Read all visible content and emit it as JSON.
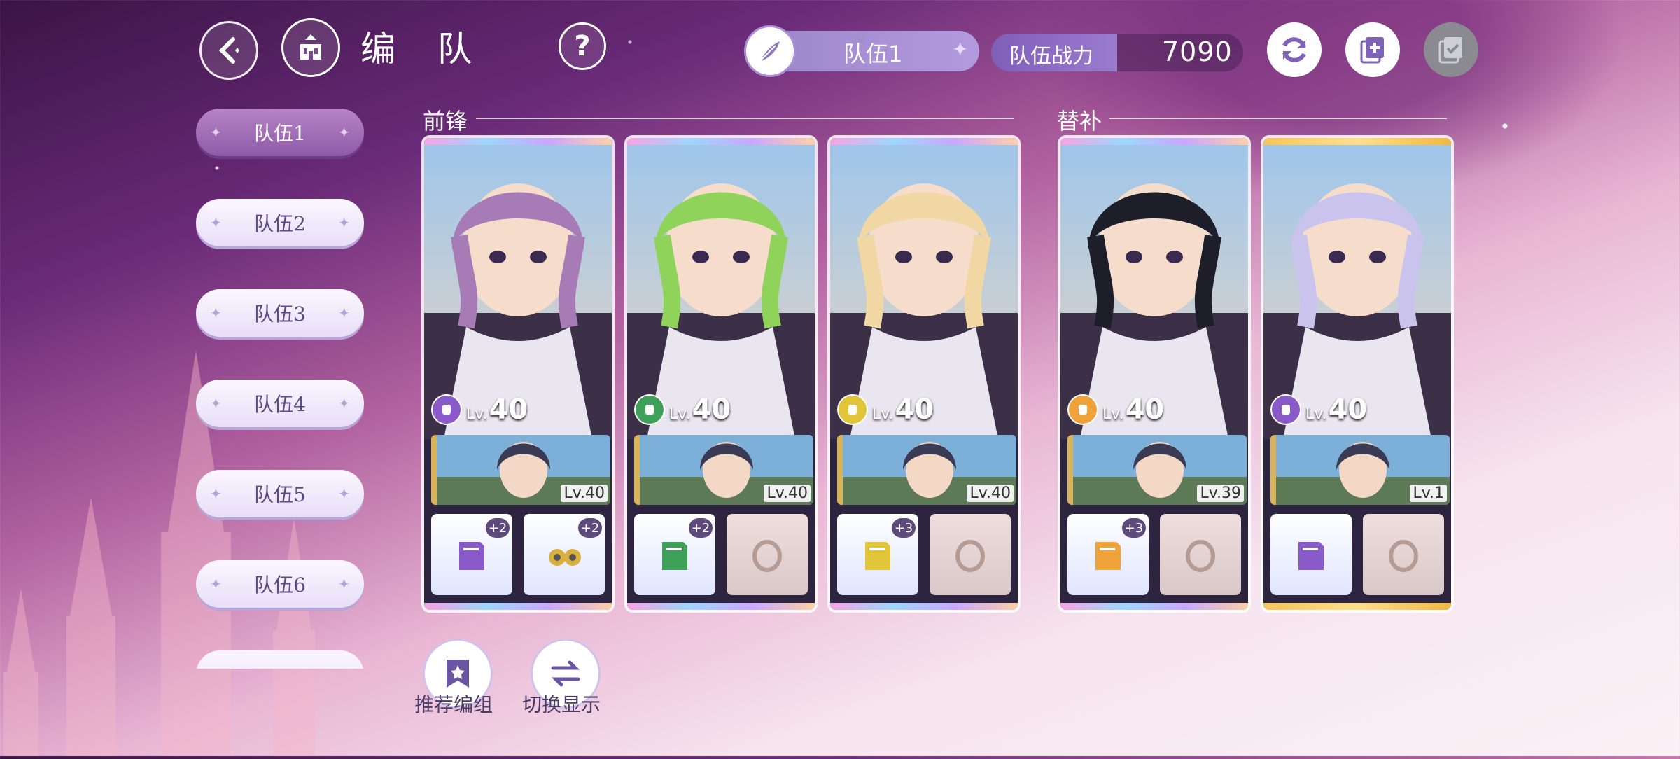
{
  "header": {
    "title": "编 队",
    "help_icon": "?",
    "current_team": "队伍1",
    "power_label": "队伍战力",
    "power_value": "7090"
  },
  "sidebar": {
    "tabs": [
      {
        "label": "队伍1",
        "active": true
      },
      {
        "label": "队伍2",
        "active": false
      },
      {
        "label": "队伍3",
        "active": false
      },
      {
        "label": "队伍4",
        "active": false
      },
      {
        "label": "队伍5",
        "active": false
      },
      {
        "label": "队伍6",
        "active": false
      }
    ]
  },
  "sections": {
    "front": "前锋",
    "bench": "替补"
  },
  "cards": [
    {
      "level_prefix": "Lv.",
      "level": "40",
      "element_color": "#8a5bc8",
      "support_level": "Lv.40",
      "equip_left_bonus": "+2",
      "equip_right_bonus": "+2",
      "hair": "#a77bb5",
      "frame": "rainbow"
    },
    {
      "level_prefix": "Lv.",
      "level": "40",
      "element_color": "#3fa05a",
      "support_level": "Lv.40",
      "equip_left_bonus": "+2",
      "equip_right_bonus": "",
      "hair": "#8fd35a",
      "frame": "rainbow"
    },
    {
      "level_prefix": "Lv.",
      "level": "40",
      "element_color": "#e0c43a",
      "support_level": "Lv.40",
      "equip_left_bonus": "+3",
      "equip_right_bonus": "",
      "hair": "#f0d7a4",
      "frame": "rainbow"
    },
    {
      "level_prefix": "Lv.",
      "level": "40",
      "element_color": "#f0a23a",
      "support_level": "Lv.39",
      "equip_left_bonus": "+3",
      "equip_right_bonus": "",
      "hair": "#1e1e2a",
      "frame": "rainbow"
    },
    {
      "level_prefix": "Lv.",
      "level": "40",
      "element_color": "#8a5bc8",
      "support_level": "Lv.1",
      "equip_left_bonus": "",
      "equip_right_bonus": "",
      "hair": "#c9c3ee",
      "frame": "gold"
    }
  ],
  "bottom_buttons": {
    "recommend": "推荐编组",
    "switch_view": "切换显示"
  },
  "icons": {
    "back": "back-arrow-icon",
    "home": "castle-icon",
    "help": "help-icon",
    "feather": "feather-icon",
    "refresh": "refresh-icon",
    "copy": "copy-add-icon",
    "check": "checklist-icon",
    "recommend": "bookmark-star-icon",
    "switch": "swap-arrows-icon"
  },
  "colors": {
    "accent": "#8f5aa9",
    "pill": "#a98fd6",
    "gold_frame": "#f1b840"
  }
}
